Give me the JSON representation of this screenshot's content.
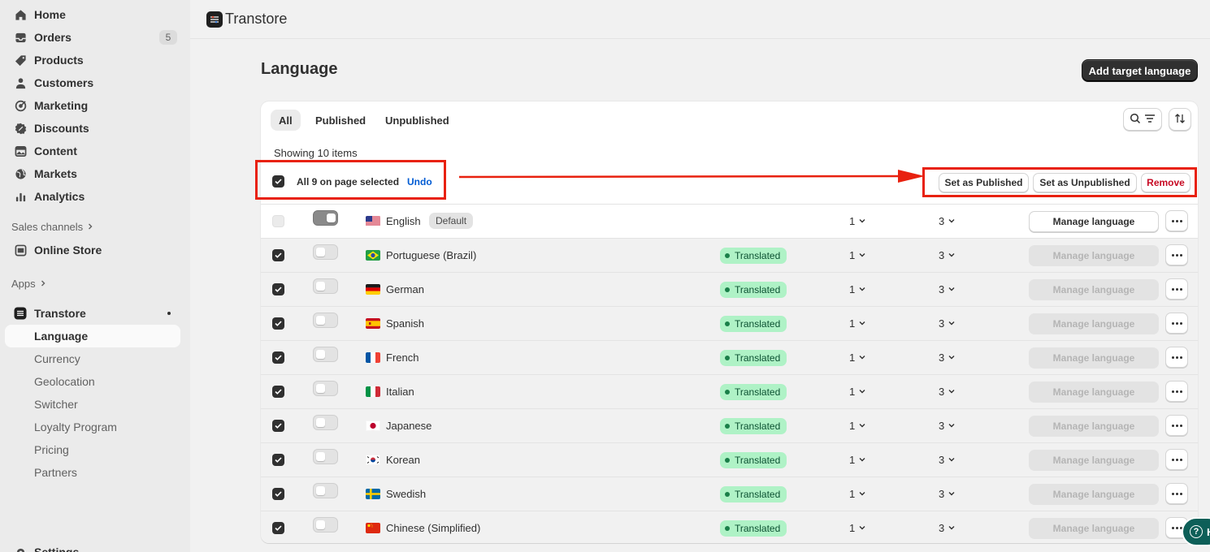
{
  "sidebar": {
    "nav": [
      {
        "label": "Home",
        "icon": "home-icon"
      },
      {
        "label": "Orders",
        "icon": "inbox-icon",
        "badge": "5"
      },
      {
        "label": "Products",
        "icon": "tag-icon"
      },
      {
        "label": "Customers",
        "icon": "person-icon"
      },
      {
        "label": "Marketing",
        "icon": "target-icon"
      },
      {
        "label": "Discounts",
        "icon": "discount-icon"
      },
      {
        "label": "Content",
        "icon": "image-icon"
      },
      {
        "label": "Markets",
        "icon": "globe-icon"
      },
      {
        "label": "Analytics",
        "icon": "bar-chart-icon"
      }
    ],
    "sales_channels_label": "Sales channels",
    "online_store_label": "Online Store",
    "apps_label": "Apps",
    "app_name": "Transtore",
    "app_sub_items": [
      "Language",
      "Currency",
      "Geolocation",
      "Switcher",
      "Loyalty Program",
      "Pricing",
      "Partners"
    ],
    "settings_label": "Settings"
  },
  "header": {
    "app_title": "Transtore"
  },
  "page": {
    "title": "Language",
    "add_button": "Add target language",
    "tabs": [
      "All",
      "Published",
      "Unpublished"
    ],
    "showing_text": "Showing 10 items",
    "bulk": {
      "selected_text": "All 9 on page selected",
      "undo_label": "Undo",
      "actions": [
        "Set as Published",
        "Set as Unpublished",
        "Remove"
      ]
    },
    "default_badge": "Default",
    "translated_label": "Translated",
    "manage_label": "Manage language",
    "rows": [
      {
        "name": "English",
        "flag": "us-flag",
        "default": true,
        "col1": "1",
        "col2": "3"
      },
      {
        "name": "Portuguese (Brazil)",
        "flag": "brazil-flag",
        "col1": "1",
        "col2": "3"
      },
      {
        "name": "German",
        "flag": "germany-flag",
        "col1": "1",
        "col2": "3"
      },
      {
        "name": "Spanish",
        "flag": "spain-flag",
        "col1": "1",
        "col2": "3"
      },
      {
        "name": "French",
        "flag": "france-flag",
        "col1": "1",
        "col2": "3"
      },
      {
        "name": "Italian",
        "flag": "italy-flag",
        "col1": "1",
        "col2": "3"
      },
      {
        "name": "Japanese",
        "flag": "japan-flag",
        "col1": "1",
        "col2": "3"
      },
      {
        "name": "Korean",
        "flag": "korea-flag",
        "col1": "1",
        "col2": "3"
      },
      {
        "name": "Swedish",
        "flag": "sweden-flag",
        "col1": "1",
        "col2": "3"
      },
      {
        "name": "Chinese (Simplified)",
        "flag": "china-flag",
        "col1": "1",
        "col2": "3"
      }
    ]
  },
  "help_label": "H",
  "colors": {
    "annotation": "#e8210f",
    "translated_bg": "#aff2c6",
    "link": "#005bd3",
    "danger": "#c70a24"
  }
}
